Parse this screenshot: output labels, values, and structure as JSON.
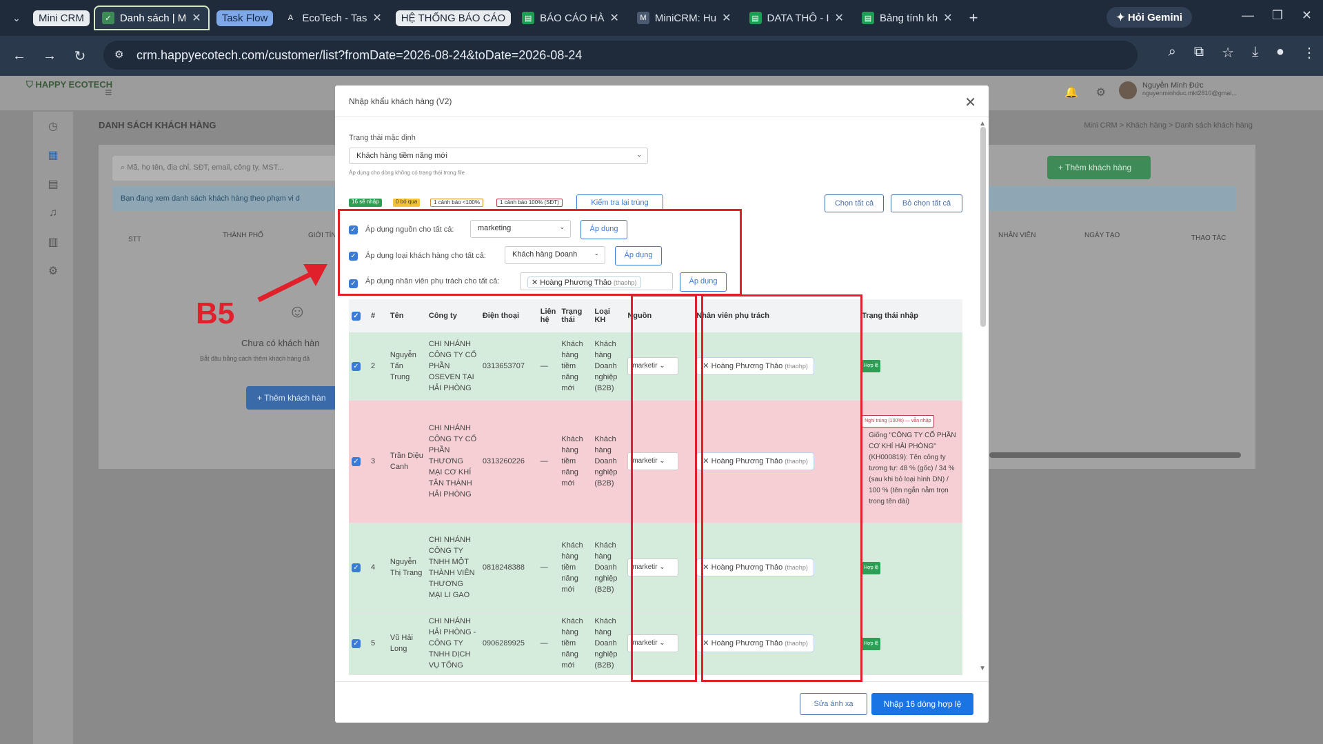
{
  "tabs": {
    "group1": "Mini CRM",
    "active": "Danh sách | M",
    "group2": "Task Flow",
    "t3": "EcoTech - Tas",
    "group3": "HỆ THỐNG BÁO CÁO",
    "t4": "BÁO CÁO HÀ",
    "t5": "MiniCRM: Hu",
    "t6": "DATA THÔ - I",
    "t7": "Bảng tính kh",
    "gemini": "Hỏi Gemini"
  },
  "url": "crm.happyecotech.com/customer/list?fromDate=2026-08-24&toDate=2026-08-24",
  "app": {
    "logo": "HAPPY ECOTECH",
    "user_name": "Nguyễn Minh Đức",
    "user_email": "nguyenminhduc.mkt2810@gmai...",
    "page_title": "DANH SÁCH KHÁCH HÀNG",
    "breadcrumb": "Mini CRM  >  Khách hàng  >  Danh sách khách hàng",
    "search_placeholder": "Mã, họ tên, địa chỉ, SĐT, email, công ty, MST...",
    "banner": "Bạn đang xem danh sách khách hàng theo phạm vi d",
    "add_customer": "+ Thêm khách hàng",
    "col_stt": "STT",
    "col_city": "THÀNH PHỐ",
    "col_gender": "GIỚI TÍN",
    "col_staff": "NHÂN VIÊN",
    "col_created": "NGÀY TẠO",
    "col_actions": "THAO TÁC",
    "empty_title": "Chưa có khách hàn",
    "empty_sub": "Bắt đầu bằng cách thêm khách hàng đầ",
    "empty_btn": "+ Thêm khách hàn"
  },
  "modal": {
    "title": "Nhập khẩu khách hàng (V2)",
    "default_status_label": "Trạng thái mặc định",
    "default_status_value": "Khách hàng tiềm năng mới",
    "default_status_hint": "Áp dụng cho dòng không có trạng thái trong file",
    "badge_import": "16 sẽ nhập",
    "badge_skip": "0 bỏ qua",
    "badge_warn": "1 cảnh báo <100%",
    "badge_dup": "1 cảnh báo 100% (SĐT)",
    "check_dup": "Kiểm tra lại trùng",
    "select_all": "Chọn tất cả",
    "deselect_all": "Bỏ chọn tất cả",
    "apply_source_label": "Áp dụng nguồn cho tất cả:",
    "apply_source_value": "marketing",
    "apply_type_label": "Áp dụng loại khách hàng cho tất cả:",
    "apply_type_value": "Khách hàng Doanh",
    "apply_staff_label": "Áp dụng nhân viên phụ trách cho tất cả:",
    "apply_staff_value": "Hoàng Phương Thảo",
    "apply_staff_user": "(thaohp)",
    "apply_btn": "Áp dụng",
    "remap": "Sửa ánh xạ",
    "import": "Nhập 16 dòng hợp lệ"
  },
  "table": {
    "headers": [
      "#",
      "Tên",
      "Công ty",
      "Điện thoại",
      "Liên hệ",
      "Trạng thái",
      "Loại KH",
      "Nguồn",
      "Nhân viên phụ trách",
      "Trạng thái nhập"
    ],
    "rows": [
      {
        "n": "2",
        "name": "Nguyễn Tấn Trung",
        "company": "CHI NHÁNH CÔNG TY CỔ PHẦN OSEVEN TẠI HẢI PHÒNG",
        "phone": "0313653707",
        "contact": "—",
        "status": "Khách hàng tiềm năng mới",
        "type": "Khách hàng Doanh nghiệp (B2B)",
        "source": "marketir",
        "staff": "Hoàng Phương Thảo",
        "user": "(thaohp)",
        "import_status": "Hợp lệ",
        "kind": "ok"
      },
      {
        "n": "3",
        "name": "Trần Diệu Canh",
        "company": "CHI NHÁNH CÔNG TY CỔ PHẦN THƯƠNG MẠI CƠ KHÍ TÂN THÀNH HẢI PHÒNG",
        "phone": "0313260226",
        "contact": "—",
        "status": "Khách hàng tiềm năng mới",
        "type": "Khách hàng Doanh nghiệp (B2B)",
        "source": "marketir",
        "staff": "Hoàng Phương Thảo",
        "user": "(thaohp)",
        "import_status": "Nghi trùng (100%) — vẫn nhập",
        "warn_text": "Giống \"CÔNG TY CỔ PHẦN CƠ KHÍ HẢI PHÒNG\" (KH000819): Tên công ty tương tự: 48 % (gốc) / 34 % (sau khi bỏ loại hình DN) / 100 % (tên ngắn nằm trọn trong tên dài)",
        "kind": "warn"
      },
      {
        "n": "4",
        "name": "Nguyễn Thị Trang",
        "company": "CHI NHÁNH CÔNG TY TNHH MỘT THÀNH VIÊN THƯƠNG MẠI LI GAO",
        "phone": "0818248388",
        "contact": "—",
        "status": "Khách hàng tiềm năng mới",
        "type": "Khách hàng Doanh nghiệp (B2B)",
        "source": "marketir",
        "staff": "Hoàng Phương Thảo",
        "user": "(thaohp)",
        "import_status": "Hợp lệ",
        "kind": "ok"
      },
      {
        "n": "5",
        "name": "Vũ Hải Long",
        "company": "CHI NHÁNH HẢI PHÒNG - CÔNG TY TNHH DỊCH VỤ TỔNG",
        "phone": "0906289925",
        "contact": "—",
        "status": "Khách hàng tiềm năng mới",
        "type": "Khách hàng Doanh nghiệp (B2B)",
        "source": "marketir",
        "staff": "Hoàng Phương Thảo",
        "user": "(thaohp)",
        "import_status": "Hợp lệ",
        "kind": "ok"
      }
    ]
  },
  "annotation": {
    "label": "B5",
    "color": "#e0202a"
  },
  "colors": {
    "primary": "#1b74e4",
    "valid": "#2f9e55",
    "warn_row": "#f5cfd3",
    "ok_row": "#d5ecdc"
  }
}
